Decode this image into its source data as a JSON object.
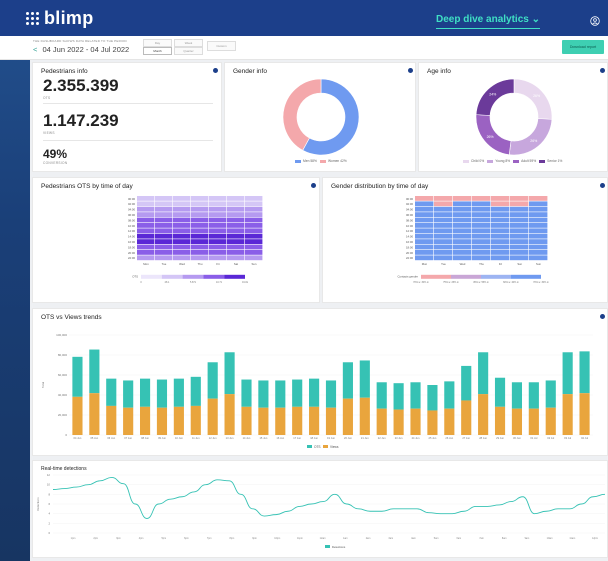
{
  "app": {
    "logo": "blimp",
    "view_selector": "Deep dive analytics",
    "download_label": "Download report"
  },
  "filter": {
    "caption": "THE DASHBOARD SHOWS DATA RELATED TO THE PERIOD",
    "period": "04 Jun 2022 - 04 Jul 2022",
    "segments": [
      {
        "label": "Day",
        "active": false
      },
      {
        "label": "Month",
        "active": true
      },
      {
        "label": "Week",
        "active": false
      },
      {
        "label": "Quarter",
        "active": false
      },
      {
        "label": "Custom",
        "active": false
      }
    ]
  },
  "pedestrians": {
    "title": "Pedestrians info",
    "ots_value": "2.355.399",
    "ots_label": "OTS",
    "views_value": "1.147.239",
    "views_label": "VIEWS",
    "conv_value": "49%",
    "conv_label": "CONVERSION"
  },
  "gender_info": {
    "title": "Gender info",
    "legend": [
      "Men 58%",
      "Women 42%"
    ],
    "colors": [
      "#6f9af0",
      "#f4a8ab"
    ],
    "chart_data": {
      "type": "pie",
      "labels": [
        "Men",
        "Women"
      ],
      "values": [
        58,
        42
      ],
      "donut": true
    }
  },
  "age_info": {
    "title": "Age info",
    "legend": [
      "Child 0%",
      "Young 8%",
      "Adult 59%",
      "Senior 1%"
    ],
    "colors": [
      "#e8d8ee",
      "#c7a7dd",
      "#9b62c2",
      "#6b3a9a"
    ],
    "slice_labels": [
      "26%",
      "26%",
      "26%",
      "24%"
    ],
    "chart_data": {
      "type": "pie",
      "labels": [
        "A",
        "B",
        "C",
        "D"
      ],
      "values": [
        26,
        26,
        24,
        24
      ],
      "donut": true
    }
  },
  "ots_time": {
    "title": "Pedestrians OTS by time of day",
    "hours": [
      "00:00",
      "02:00",
      "04:00",
      "06:00",
      "08:00",
      "10:00",
      "12:00",
      "14:00",
      "16:00",
      "18:00",
      "20:00",
      "22:00"
    ],
    "days": [
      "Mon",
      "Tue",
      "Wed",
      "Thu",
      "Fri",
      "Sat",
      "Sun"
    ],
    "scale_label": "OTS",
    "scale_ticks": [
      "0",
      "28.1",
      "5.871",
      "10.71",
      "19.0k"
    ]
  },
  "gender_time": {
    "title": "Gender distribution by time of day",
    "hours": [
      "00:00",
      "02:00",
      "04:00",
      "06:00",
      "08:00",
      "10:00",
      "12:00",
      "14:00",
      "16:00",
      "18:00",
      "20:00",
      "22:00"
    ],
    "days": [
      "Mon",
      "Tue",
      "Wed",
      "Thu",
      "Fri",
      "Sat",
      "Sun"
    ],
    "scale_label": "Contacts gender",
    "scale_ticks": [
      "70% w. 30% m",
      "75% w. 25% m",
      "45% w. 55% m",
      "60% w. 40% m",
      "70% w. 30% m"
    ]
  },
  "trends": {
    "title": "OTS vs Views trends",
    "ylabel": "Total",
    "legend": [
      "OTS",
      "Views"
    ],
    "colors": [
      "#36c2b4",
      "#e9a53d"
    ],
    "chart_data": {
      "type": "bar",
      "categories": [
        "04 Jun",
        "05 Jun",
        "06 Jun",
        "07 Jun",
        "08 Jun",
        "09 Jun",
        "10 Jun",
        "11 Jun",
        "12 Jun",
        "13 Jun",
        "14 Jun",
        "15 Jun",
        "16 Jun",
        "17 Jun",
        "18 Jun",
        "19 Jun",
        "20 Jun",
        "21 Jun",
        "22 Jun",
        "23 Jun",
        "24 Jun",
        "25 Jun",
        "26 Jun",
        "27 Jun",
        "28 Jun",
        "29 Jun",
        "30 Jun",
        "01 Jul",
        "02 Jul",
        "03 Jul",
        "04 Jul"
      ],
      "y_ticks": [
        "100,000",
        "80,000",
        "60,000",
        "40,000",
        "20,000",
        "0"
      ],
      "ylim": [
        0,
        110000
      ],
      "series": [
        {
          "name": "OTS",
          "values": [
            86000,
            94000,
            62000,
            60000,
            62000,
            61000,
            62000,
            64000,
            80000,
            91000,
            61000,
            60000,
            60000,
            61000,
            62000,
            60000,
            80000,
            82000,
            58000,
            57000,
            58000,
            55000,
            59000,
            76000,
            91000,
            63000,
            58000,
            58000,
            60000,
            91000,
            92000
          ]
        },
        {
          "name": "Views",
          "values": [
            42000,
            46000,
            32000,
            30000,
            31000,
            30000,
            31000,
            32000,
            40000,
            45000,
            31000,
            30000,
            30000,
            31000,
            31000,
            30000,
            40000,
            41000,
            29000,
            28000,
            29000,
            27000,
            29000,
            38000,
            45000,
            31000,
            29000,
            29000,
            30000,
            45000,
            46000
          ]
        }
      ]
    }
  },
  "realtime": {
    "title": "Real-time detections",
    "ylabel": "Detections",
    "legend": [
      "Detections"
    ],
    "y_ticks": [
      "12",
      "10",
      "8",
      "6",
      "4",
      "2",
      "0"
    ],
    "x_ticks": [
      "1pm",
      "2pm",
      "3pm",
      "4pm",
      "5pm",
      "6pm",
      "7pm",
      "8pm",
      "9pm",
      "10pm",
      "11pm",
      "12am",
      "1am",
      "2am",
      "3am",
      "4am",
      "5am",
      "6am",
      "7am",
      "8am",
      "9am",
      "10am",
      "11am",
      "12pm"
    ],
    "chart_data": {
      "type": "line",
      "x": [
        0,
        1,
        2,
        3,
        4,
        5,
        6,
        7,
        8,
        9,
        10,
        11,
        12,
        13,
        14,
        15,
        16,
        17,
        18,
        19,
        20,
        21,
        22,
        23,
        24,
        25,
        26,
        27,
        28,
        29,
        30,
        31,
        32,
        33,
        34,
        35,
        36,
        37,
        38,
        39,
        40,
        41,
        42,
        43,
        44,
        45,
        46,
        47
      ],
      "y": [
        9,
        9.2,
        9.5,
        10,
        10.8,
        11.5,
        10.2,
        6,
        3,
        6,
        7,
        7.5,
        8.5,
        10,
        11,
        10.8,
        8,
        5,
        3.5,
        3.8,
        4.5,
        5.5,
        6,
        6.5,
        8,
        6,
        5,
        4.5,
        4.5,
        5,
        5,
        5,
        4.2,
        4,
        4,
        4.5,
        5.5,
        5.5,
        5.8,
        6.5,
        7.5,
        4,
        4.5,
        5,
        5,
        6,
        7.5,
        8
      ],
      "ylim": [
        0,
        12
      ]
    }
  }
}
